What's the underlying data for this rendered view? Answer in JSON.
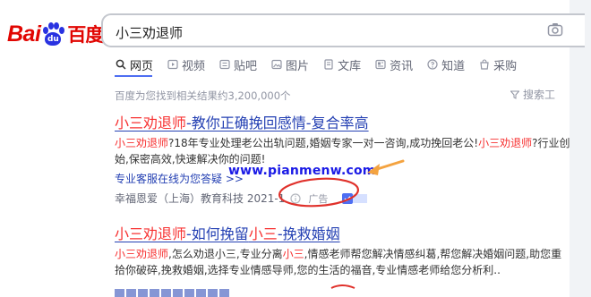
{
  "header": {
    "logo": {
      "part1": "Bai",
      "paw": "du",
      "part2": "百度"
    },
    "search": {
      "value": "小三劝退师"
    }
  },
  "tabs": [
    {
      "label": "网页",
      "icon": "search-icon",
      "active": true
    },
    {
      "label": "视频",
      "icon": "video-icon"
    },
    {
      "label": "贴吧",
      "icon": "tieba-icon"
    },
    {
      "label": "图片",
      "icon": "image-icon"
    },
    {
      "label": "文库",
      "icon": "doc-icon"
    },
    {
      "label": "资讯",
      "icon": "news-icon"
    },
    {
      "label": "知道",
      "icon": "question-icon"
    },
    {
      "label": "采购",
      "icon": "shop-icon"
    }
  ],
  "result_count": "百度为您找到相关结果约3,200,000个",
  "tools_label": "搜索工",
  "results": [
    {
      "title": {
        "kw": "小三劝退师",
        "rest": "-教你正确挽回感情-复合率高"
      },
      "desc": {
        "kw1": "小三劝退师",
        "text1": "?18年专业处理老公出轨问题,婚姻专家一对一咨询,成功挽回老公!",
        "kw2": "小三劝退师",
        "text2": "?行业创始,保密高效,快速解决你的问题!"
      },
      "link": "专业客服在线为您答疑 >>",
      "source": "幸福恩爱（上海）教育科技 2021-1",
      "ad": "广告"
    },
    {
      "title": {
        "kw1": "小三劝退师",
        "mid": "-如何挽留",
        "kw2": "小三",
        "rest": "-挽救婚姻"
      },
      "desc": {
        "kw1": "小三劝退师",
        "t1": ",怎么劝退小三,专业分离",
        "kw2": "小三",
        "t2": ",情感老师帮您解决情感纠葛,帮您解决婚姻问题,助您重拾你破碎,挽救婚姻,选择专业情感导师,您的生活的福音,专业情感老师给您分析利.."
      }
    }
  ],
  "watermark": "www.pianmenw.com",
  "colors": {
    "brand_red": "#e10602",
    "brand_blue": "#2932e1",
    "link": "#2440b3",
    "keyword": "#f73131",
    "annotation": "#e0312b",
    "arrow": "#f4a340"
  }
}
